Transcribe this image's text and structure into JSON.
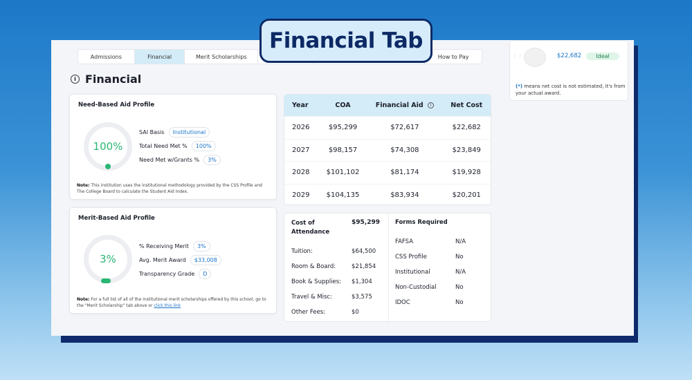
{
  "title_badge": "Financial Tab",
  "tabs": [
    {
      "label": "Admissions",
      "active": false
    },
    {
      "label": "Financial",
      "active": true
    },
    {
      "label": "Merit Scholarships",
      "active": false
    },
    {
      "label": "",
      "active": false
    },
    {
      "label": "",
      "active": false
    },
    {
      "label": "How to Pay",
      "active": false
    }
  ],
  "section": {
    "title": "Financial"
  },
  "need_based": {
    "title": "Need-Based Aid Profile",
    "ring_value": "100%",
    "ring_progress": 1.0,
    "rows": [
      {
        "label": "SAI Basis",
        "value": "Institutional"
      },
      {
        "label": "Total Need Met %",
        "value": "100%"
      },
      {
        "label": "Need Met w/Grants %",
        "value": "3%"
      }
    ],
    "note_label": "Note:",
    "note_text": "This institution uses the institutional methodology provided by the CSS Profile and The College Board to calculate the Student Aid Index."
  },
  "merit_based": {
    "title": "Merit-Based Aid Profile",
    "ring_value": "3%",
    "ring_progress": 0.03,
    "rows": [
      {
        "label": "% Receiving Merit",
        "value": "3%"
      },
      {
        "label": "Avg. Merit Award",
        "value": "$33,008"
      },
      {
        "label": "Transparency Grade",
        "value": "D"
      }
    ],
    "note_label": "Note:",
    "note_text": "For a full list of all of the institutional merit scholarships offered by this school, go to the \"Merit Scholarship\" tab above or",
    "note_link": "click this link"
  },
  "cost_table": {
    "headers": [
      "Year",
      "COA",
      "Financial Aid",
      "Net Cost"
    ],
    "rows": [
      [
        "2026",
        "$95,299",
        "$72,617",
        "$22,682"
      ],
      [
        "2027",
        "$98,157",
        "$74,308",
        "$23,849"
      ],
      [
        "2028",
        "$101,102",
        "$81,174",
        "$19,928"
      ],
      [
        "2029",
        "$104,135",
        "$83,934",
        "$20,201"
      ]
    ]
  },
  "coa_breakdown": {
    "header_label": "Cost of Attendance",
    "header_value": "$95,299",
    "items": [
      {
        "label": "Tuition:",
        "value": "$64,500"
      },
      {
        "label": "Room & Board:",
        "value": "$21,854"
      },
      {
        "label": "Book & Supplies:",
        "value": "$1,304"
      },
      {
        "label": "Travel & Misc:",
        "value": "$3,575"
      },
      {
        "label": "Other Fees:",
        "value": "$0"
      }
    ]
  },
  "forms": {
    "title": "Forms Required",
    "items": [
      {
        "label": "FAFSA",
        "value": "N/A"
      },
      {
        "label": "CSS Profile",
        "value": "No"
      },
      {
        "label": "Institutional",
        "value": "N/A"
      },
      {
        "label": "Non-Custodial",
        "value": "No"
      },
      {
        "label": "IDOC",
        "value": "No"
      }
    ]
  },
  "side": {
    "net_cost": "$22,682",
    "badge": "Ideal",
    "note_star": "(*)",
    "note_text": "means net cost is not estimated, it's from your actual award."
  },
  "colors": {
    "accent": "#2bb673",
    "link": "#1a73c8",
    "header_bg": "#d3ecf8",
    "navy": "#0d2a66"
  }
}
